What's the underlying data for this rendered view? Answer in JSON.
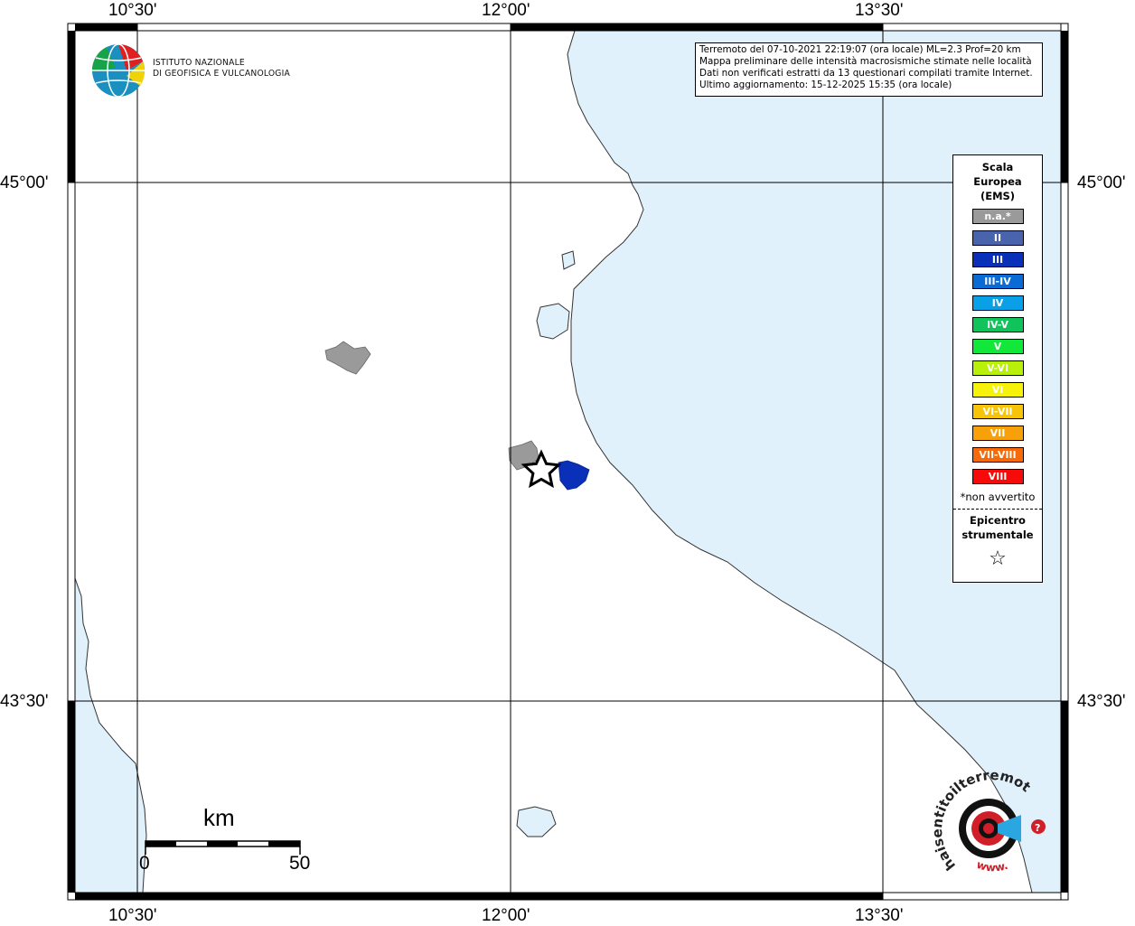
{
  "axis": {
    "lon_labels": [
      "10°30'",
      "12°00'",
      "13°30'"
    ],
    "lat_labels": [
      "45°00'",
      "43°30'"
    ]
  },
  "info": {
    "line1": "Terremoto del 07-10-2021 22:19:07 (ora locale) ML=2.3 Prof=20 km",
    "line2": "Mappa preliminare delle intensità macrosismiche stimate nelle località",
    "line3": "Dati non verificati estratti da 13 questionari compilati tramite Internet.",
    "line4": "Ultimo aggiornamento: 15-12-2025 15:35 (ora locale)"
  },
  "ingv": {
    "line1": "ISTITUTO NAZIONALE",
    "line2": "DI GEOFISICA E VULCANOLOGIA"
  },
  "legend": {
    "title1": "Scala",
    "title2": "Europea",
    "title3": "(EMS)",
    "items": [
      {
        "label": "n.a.*",
        "color": "#9a9a9a"
      },
      {
        "label": "II",
        "color": "#4a63ad"
      },
      {
        "label": "III",
        "color": "#0a2fb8"
      },
      {
        "label": "III-IV",
        "color": "#0a6ad6"
      },
      {
        "label": "IV",
        "color": "#0aa0e8"
      },
      {
        "label": "IV-V",
        "color": "#10c35a"
      },
      {
        "label": "V",
        "color": "#11e83a"
      },
      {
        "label": "V-VI",
        "color": "#b8f00a"
      },
      {
        "label": "VI",
        "color": "#f7f20a"
      },
      {
        "label": "VI-VII",
        "color": "#f7c40a"
      },
      {
        "label": "VII",
        "color": "#f7a00a"
      },
      {
        "label": "VII-VIII",
        "color": "#f76a0a"
      },
      {
        "label": "VIII",
        "color": "#f70a0a"
      }
    ],
    "note": "*non avvertito",
    "epi1": "Epicentro",
    "epi2": "strumentale",
    "star": "☆"
  },
  "scale": {
    "title": "km",
    "zero": "0",
    "max": "50"
  },
  "hst": {
    "text": "haisentitoilterremoto.it",
    "www": "www."
  },
  "colors": {
    "sea": "#e0f1fc",
    "na": "#9a9a9a",
    "intensity_iii": "#0a2fb8"
  }
}
